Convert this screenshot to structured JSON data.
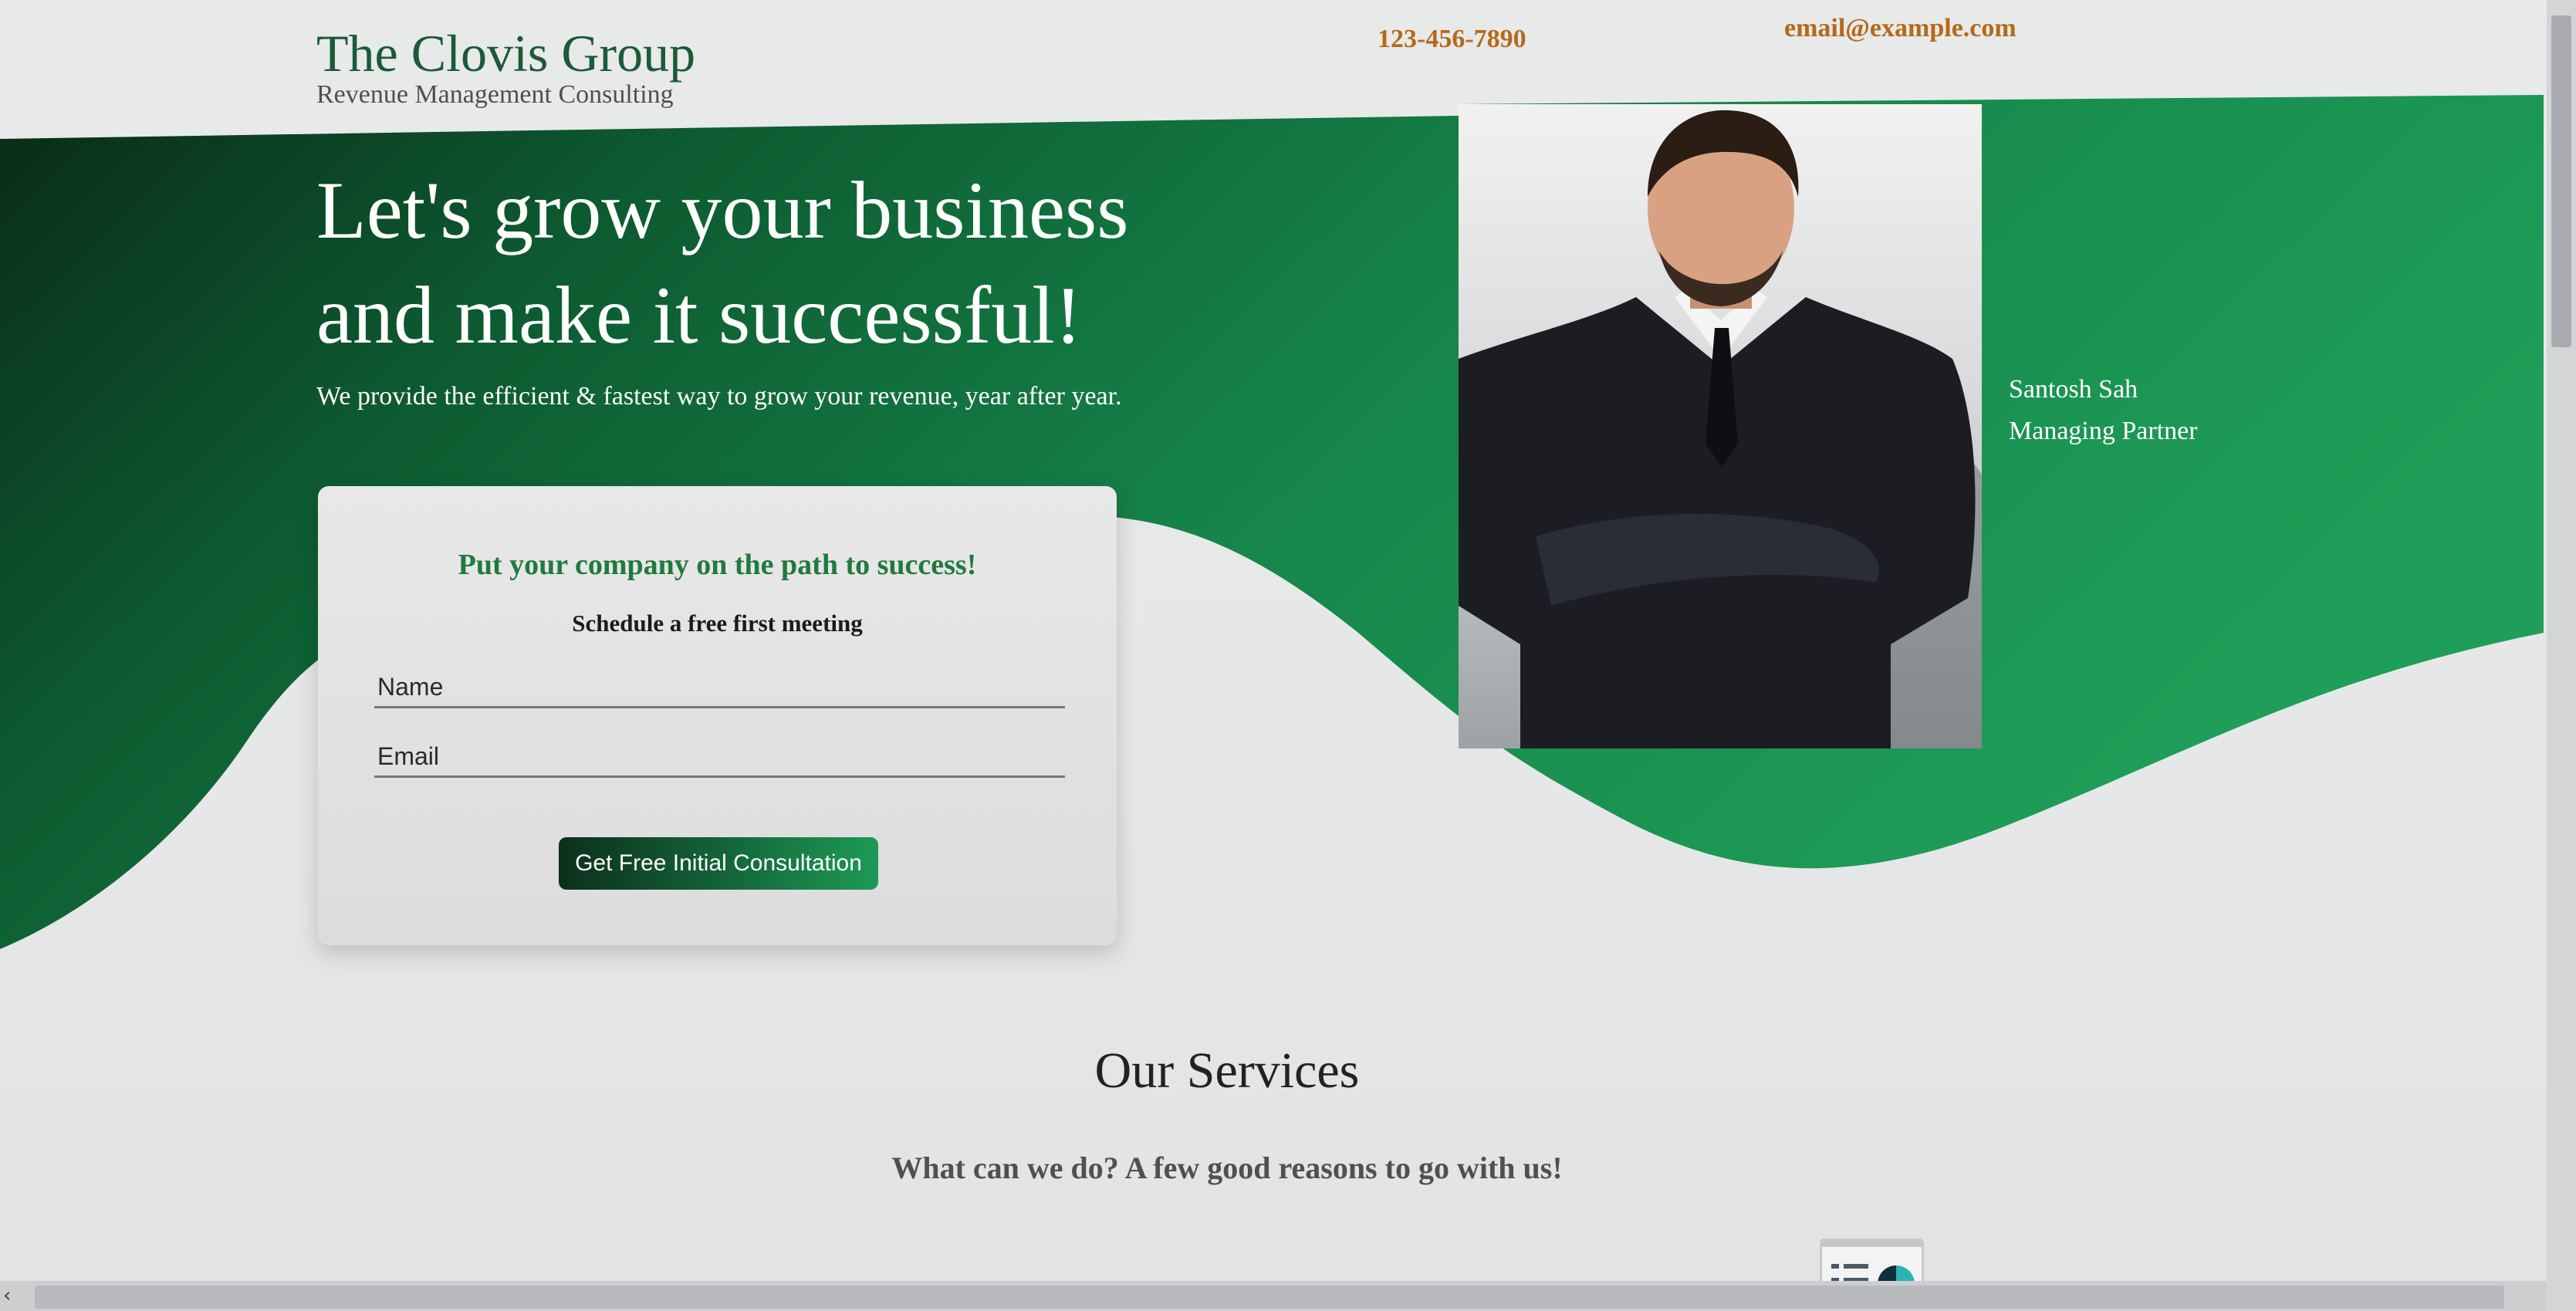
{
  "header": {
    "logo_title": "The Clovis Group",
    "logo_subtitle": "Revenue Management Consulting",
    "phone": "123-456-7890",
    "email": "email@example.com"
  },
  "hero": {
    "title_line1": "Let's grow your business",
    "title_line2": "and make it successful!",
    "subtitle": "We provide the efficient & fastest way to grow your revenue, year after year."
  },
  "person": {
    "name": "Santosh Sah",
    "role": "Managing Partner"
  },
  "form": {
    "title": "Put your company on the path to success!",
    "subtitle": "Schedule a free first meeting",
    "name_placeholder": "Name",
    "email_placeholder": "Email",
    "submit_label": "Get Free Initial Consultation"
  },
  "services": {
    "title": "Our Services",
    "subtitle": "What can we do? A few good reasons to go with us!"
  },
  "colors": {
    "brand_green": "#1f7a3e",
    "dark_green": "#0c3a22",
    "light_green": "#1e9a56",
    "accent_orange": "#b36a1a"
  },
  "icons": [
    "portrait-photo",
    "chart-window-icon",
    "chevron-left-icon"
  ]
}
